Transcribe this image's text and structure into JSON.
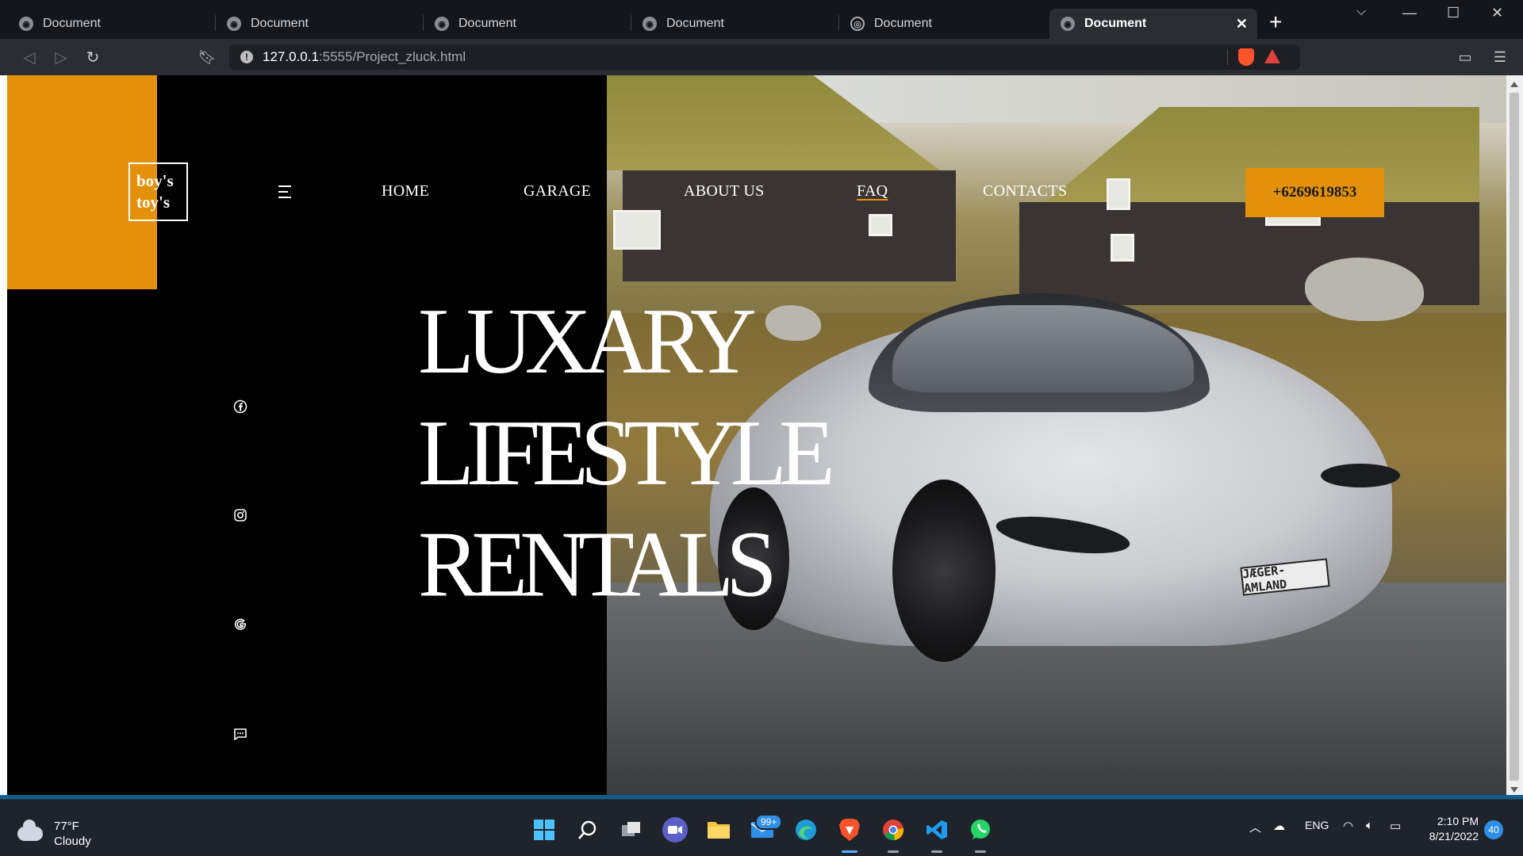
{
  "browser": {
    "tabs": [
      {
        "title": "Document",
        "icon": "radio-icon",
        "active": false
      },
      {
        "title": "Document",
        "icon": "radio-icon",
        "active": false
      },
      {
        "title": "Document",
        "icon": "radio-icon",
        "active": false
      },
      {
        "title": "Document",
        "icon": "radio-icon",
        "active": false
      },
      {
        "title": "Document",
        "icon": "globe-icon",
        "active": false
      },
      {
        "title": "Document",
        "icon": "radio-icon",
        "active": true
      }
    ],
    "url_host": "127.0.0.1",
    "url_path": ":5555/Project_zluck.html"
  },
  "site": {
    "logo": {
      "line1": "boy's",
      "line2": "toy's"
    },
    "nav": [
      "HOME",
      "GARAGE",
      "ABOUT US",
      "FAQ",
      "CONTACTS"
    ],
    "phone": "+6269619853",
    "headline": [
      "LUXARY",
      "LIFESTYLE",
      "RENTALS"
    ],
    "plate": "JÆGER-AMLAND",
    "social_icons": [
      "facebook-icon",
      "instagram-icon",
      "google-icon",
      "chat-icon"
    ],
    "colors": {
      "accent": "#e3900a",
      "background": "#000000",
      "text": "#ffffff"
    }
  },
  "taskbar": {
    "weather": {
      "temp": "77°F",
      "condition": "Cloudy"
    },
    "mail_badge": "99+",
    "language": "ENG",
    "time": "2:10 PM",
    "date": "8/21/2022",
    "notification_count": "40"
  }
}
